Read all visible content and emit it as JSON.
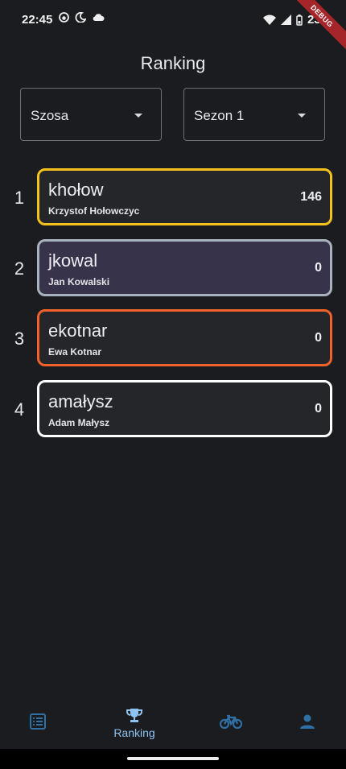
{
  "status_bar": {
    "time": "22:45",
    "battery": "23%",
    "debug_banner": "DEBUG",
    "icons_left": [
      "face-icon",
      "moon-icon",
      "cloud-icon"
    ],
    "icons_right": [
      "wifi-icon",
      "signal-icon",
      "battery-icon"
    ]
  },
  "page": {
    "title": "Ranking"
  },
  "filters": {
    "discipline": "Szosa",
    "season": "Sezon 1"
  },
  "ranking": [
    {
      "rank": "1",
      "nick": "khołow",
      "name": "Krzystof Hołowczyc",
      "points": "146",
      "border_color": "#f5c21b",
      "bg_color": "#24262a"
    },
    {
      "rank": "2",
      "nick": "jkowal",
      "name": "Jan Kowalski",
      "points": "0",
      "border_color": "#a8b2bf",
      "bg_color": "#37334a"
    },
    {
      "rank": "3",
      "nick": "ekotnar",
      "name": "Ewa Kotnar",
      "points": "0",
      "border_color": "#f0622a",
      "bg_color": "#24262a"
    },
    {
      "rank": "4",
      "nick": "amałysz",
      "name": "Adam Małysz",
      "points": "0",
      "border_color": "#ffffff",
      "bg_color": "#24262a"
    }
  ],
  "bottom_nav": {
    "active_label": "Ranking",
    "items": [
      "list-icon",
      "trophy-icon",
      "bike-icon",
      "person-icon"
    ],
    "icon_color": "#2f6fa3",
    "active_color": "#8fc3f2"
  }
}
